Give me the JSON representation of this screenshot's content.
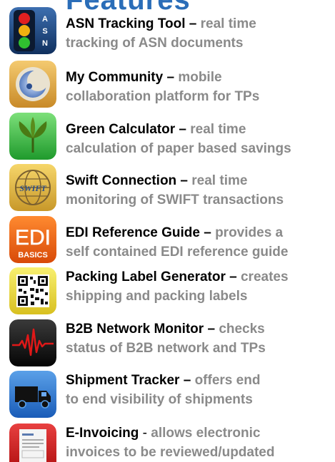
{
  "header": {
    "partial_text": "Features"
  },
  "apps": [
    {
      "icon": "traffic-light-asn-icon",
      "title": "ASN Tracking Tool",
      "sep": " – ",
      "desc_line1": "real time",
      "desc_line2": "tracking of ASN documents",
      "letters": [
        "A",
        "S",
        "N"
      ]
    },
    {
      "icon": "crescent-moon-icon",
      "title": "My Community",
      "sep": " – ",
      "desc_line1": "mobile",
      "desc_line2": "collaboration platform for TPs"
    },
    {
      "icon": "green-leaf-icon",
      "title": "Green Calculator",
      "sep": " – ",
      "desc_line1": "real time",
      "desc_line2": "calculation of paper based savings"
    },
    {
      "icon": "swift-globe-icon",
      "title": "Swift Connection",
      "sep": " – ",
      "desc_line1": "real time",
      "desc_line2": "monitoring of SWIFT transactions",
      "icon_text": "SWIFT"
    },
    {
      "icon": "edi-basics-icon",
      "title": "EDI Reference Guide",
      "sep": " – ",
      "desc_line1": "provides a",
      "desc_line2": "self contained EDI reference guide",
      "icon_text": "EDI",
      "icon_subtext": "BASICS"
    },
    {
      "icon": "qr-code-icon",
      "title": "Packing Label Generator",
      "sep": " – ",
      "desc_line1": "creates",
      "desc_line2": "shipping and packing labels"
    },
    {
      "icon": "heartbeat-monitor-icon",
      "title": "B2B Network Monitor",
      "sep": " – ",
      "desc_line1": "checks",
      "desc_line2": "status of B2B network and TPs"
    },
    {
      "icon": "truck-icon",
      "title": "Shipment Tracker",
      "sep": " – ",
      "desc_line1": "offers end",
      "desc_line2": "to end visibility of shipments"
    },
    {
      "icon": "invoice-document-icon",
      "title": "E-Invoicing",
      "sep": " - ",
      "desc_line1": "allows electronic",
      "desc_line2": "invoices to be reviewed/updated"
    }
  ]
}
